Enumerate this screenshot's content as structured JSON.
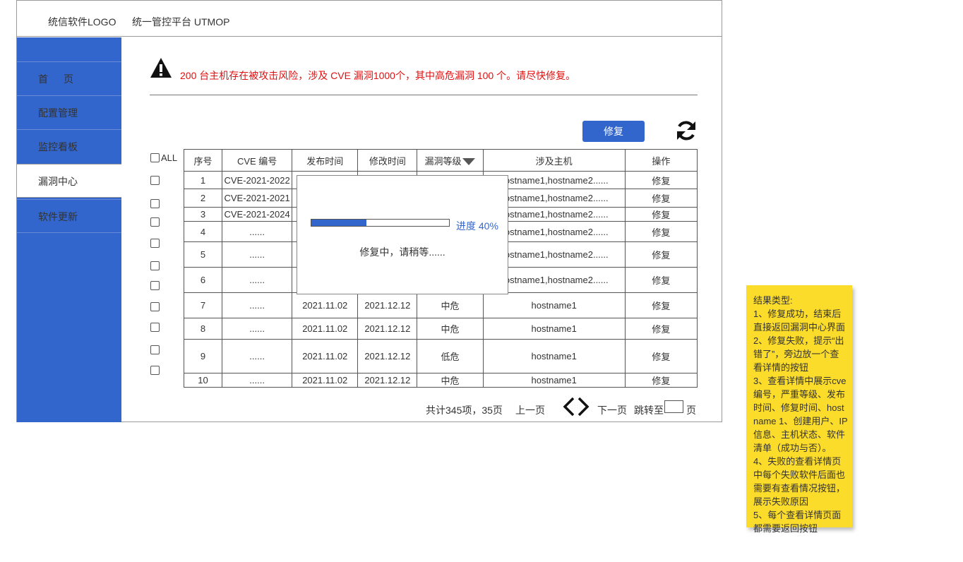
{
  "header": {
    "logo": "统信软件LOGO",
    "title": "统一管控平台 UTMOP"
  },
  "sidebar": {
    "items": [
      {
        "label": "首页"
      },
      {
        "label": "配置管理"
      },
      {
        "label": "监控看板"
      },
      {
        "label": "漏洞中心",
        "active": true
      },
      {
        "label": "软件更新"
      }
    ]
  },
  "alert": {
    "icon": "warning-icon",
    "text": "200 台主机存在被攻击风险，涉及 CVE 漏洞1000个，其中高危漏洞 100 个。请尽快修复。",
    "color": "#e01010"
  },
  "toolbar": {
    "repair_label": "修复",
    "refresh_icon": "refresh-icon"
  },
  "table": {
    "select_all_label": "ALL",
    "headers": [
      "序号",
      "CVE 编号",
      "发布时间",
      "修改时间",
      "漏洞等级",
      "涉及主机",
      "操作"
    ],
    "rows": [
      {
        "no": "1",
        "cve": "CVE-2021-2022",
        "publish": "",
        "modify": "",
        "level": "",
        "hosts": "hostname1,hostname2......",
        "action": "修复"
      },
      {
        "no": "2",
        "cve": "CVE-2021-2021",
        "publish": "",
        "modify": "",
        "level": "",
        "hosts": "hostname1,hostname2......",
        "action": "修复"
      },
      {
        "no": "3",
        "cve": "CVE-2021-2024",
        "publish": "",
        "modify": "",
        "level": "",
        "hosts": "hostname1,hostname2......",
        "action": "修复"
      },
      {
        "no": "4",
        "cve": "......",
        "publish": "",
        "modify": "",
        "level": "",
        "hosts": "hostname1,hostname2......",
        "action": "修复"
      },
      {
        "no": "5",
        "cve": "......",
        "publish": "",
        "modify": "",
        "level": "",
        "hosts": "hostname1,hostname2......",
        "action": "修复"
      },
      {
        "no": "6",
        "cve": "......",
        "publish": "",
        "modify": "",
        "level": "",
        "hosts": "hostname1,hostname2......",
        "action": "修复"
      },
      {
        "no": "7",
        "cve": "......",
        "publish": "2021.11.02",
        "modify": "2021.12.12",
        "level": "中危",
        "hosts": "hostname1",
        "action": "修复"
      },
      {
        "no": "8",
        "cve": "......",
        "publish": "2021.11.02",
        "modify": "2021.12.12",
        "level": "中危",
        "hosts": "hostname1",
        "action": "修复"
      },
      {
        "no": "9",
        "cve": "......",
        "publish": "2021.11.02",
        "modify": "2021.12.12",
        "level": "低危",
        "hosts": "hostname1",
        "action": "修复"
      },
      {
        "no": "10",
        "cve": "......",
        "publish": "2021.11.02",
        "modify": "2021.12.12",
        "level": "中危",
        "hosts": "hostname1",
        "action": "修复"
      }
    ]
  },
  "modal": {
    "progress": 0.4,
    "progress_label": "进度 40%",
    "message": "修复中，请稍等......"
  },
  "pager": {
    "total": "共计345项，35页",
    "prev": "上一页",
    "next": "下一页",
    "jump_label": "跳转至",
    "unit": "页",
    "jump_value": ""
  },
  "note": {
    "lines": [
      "结果类型:",
      "1、修复成功，结束后直接返回漏洞中心界面",
      "2、修复失败，提示“出错了”，旁边放一个查看详情的按钮",
      "3、查看详情中展示cve编号，严重等级、发布时间、修复时间、hostname 1、创建用户、IP信息、主机状态、软件清单（成功与否）。",
      "4、失败的查看详情页中每个失败软件后面也需要有查看情况按钮，展示失败原因",
      "5、每个查看详情页面都需要返回按钮"
    ]
  }
}
